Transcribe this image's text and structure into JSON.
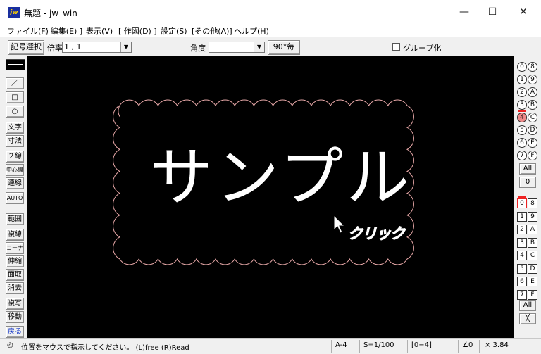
{
  "window": {
    "title": "無題 - jw_win",
    "icon_label": "jw",
    "minimize": "—",
    "maximize": "☐",
    "close": "✕"
  },
  "menu": [
    "ファイル(F)",
    "[ 編集(E) ]",
    "表示(V)",
    "[ 作図(D) ]",
    "設定(S)",
    "[その他(A)]",
    "ヘルプ(H)"
  ],
  "toolbar": {
    "symbol_select": "記号選択",
    "scale_label": "倍率",
    "scale_value": "1 , 1",
    "angle_label": "角度",
    "angle_value": "",
    "every90": "90°毎",
    "group_label": "グループ化",
    "group_checked": false
  },
  "left_tools": [
    "／",
    "□",
    "○",
    "文字",
    "寸法",
    "２線",
    "中心線",
    "連線",
    "AUTO",
    "範囲",
    "複線",
    "コーナー",
    "伸縮",
    "面取",
    "消去",
    "複写",
    "移動",
    "戻る"
  ],
  "canvas": {
    "sample_text": "サンプル",
    "click_label": "クリック",
    "background": "#000000",
    "cloud_color": "#e8a8a8"
  },
  "right_panel": {
    "layer_group_rows": [
      [
        "0",
        "8"
      ],
      [
        "1",
        "9"
      ],
      [
        "2",
        "A"
      ],
      [
        "3",
        "B"
      ],
      [
        "4",
        "C"
      ],
      [
        "5",
        "D"
      ],
      [
        "6",
        "E"
      ],
      [
        "7",
        "F"
      ]
    ],
    "layer_group_active": "4",
    "all_label_1": "All",
    "zero_label": "0",
    "layer_rows": [
      [
        "0",
        "8"
      ],
      [
        "1",
        "9"
      ],
      [
        "2",
        "A"
      ],
      [
        "3",
        "B"
      ],
      [
        "4",
        "C"
      ],
      [
        "5",
        "D"
      ],
      [
        "6",
        "E"
      ],
      [
        "7",
        "F"
      ]
    ],
    "layer_active": "0",
    "all_label_2": "All",
    "cross_label": "╳"
  },
  "status": {
    "icon": "◎",
    "message": "位置をマウスで指示してください。 (L)free (R)Read",
    "paper": "A-4",
    "scale": "S=1/100",
    "layer": "[0−4]",
    "angle": "∠0",
    "zoom": "× 3.84"
  }
}
